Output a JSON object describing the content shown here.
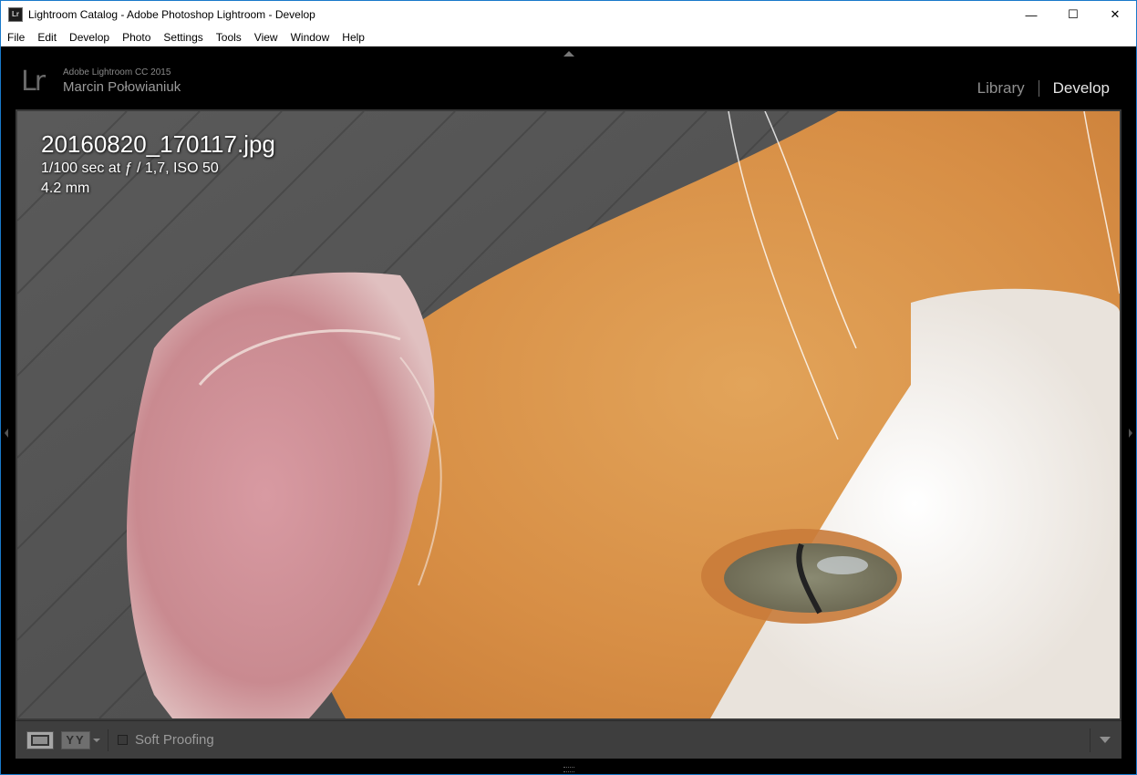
{
  "titlebar": {
    "icon_text": "Lr",
    "title": "Lightroom Catalog - Adobe Photoshop Lightroom - Develop",
    "minimize": "—",
    "maximize": "☐",
    "close": "✕"
  },
  "menu": [
    "File",
    "Edit",
    "Develop",
    "Photo",
    "Settings",
    "Tools",
    "View",
    "Window",
    "Help"
  ],
  "identity": {
    "logo": "Lr",
    "product": "Adobe Lightroom CC 2015",
    "user": "Marcin Połowianiuk"
  },
  "modules": {
    "library": "Library",
    "develop": "Develop",
    "active": "Develop"
  },
  "photo_info": {
    "filename": "20160820_170117.jpg",
    "exposure": "1/100 sec at ƒ / 1,7, ISO 50",
    "focal": "4.2 mm"
  },
  "toolbar": {
    "before_after_glyph": "YY",
    "soft_proofing_label": "Soft Proofing",
    "soft_proofing_checked": false
  },
  "colors": {
    "title_accent": "#1979ca",
    "app_bg": "#000000",
    "toolbar_bg": "#3e3e3e",
    "active_module": "#e5e5e5",
    "inactive_module": "#8f8f8f"
  }
}
